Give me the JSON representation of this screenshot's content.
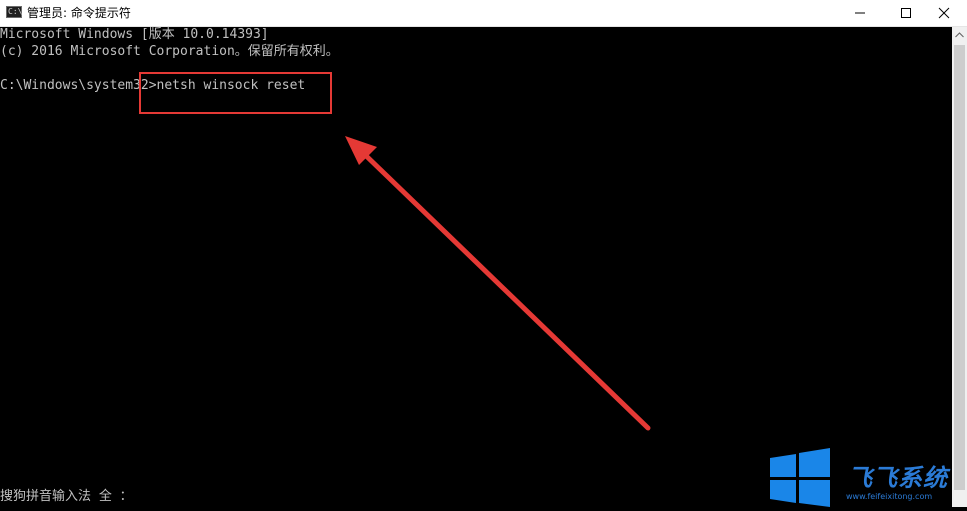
{
  "window": {
    "title": "管理员: 命令提示符",
    "icon": "console-icon",
    "icon_glyph": "C:\\"
  },
  "console": {
    "lines": [
      "Microsoft Windows [版本 10.0.14393]",
      "(c) 2016 Microsoft Corporation。保留所有权利。",
      "C:\\Windows\\system32>netsh winsock reset"
    ],
    "ime_status": "搜狗拼音输入法 全 ："
  },
  "annotation": {
    "highlight_color": "#e53935"
  },
  "watermark": {
    "text": "飞飞系统",
    "url": "www.feifeixitong.com",
    "color": "#2b7bd6"
  }
}
